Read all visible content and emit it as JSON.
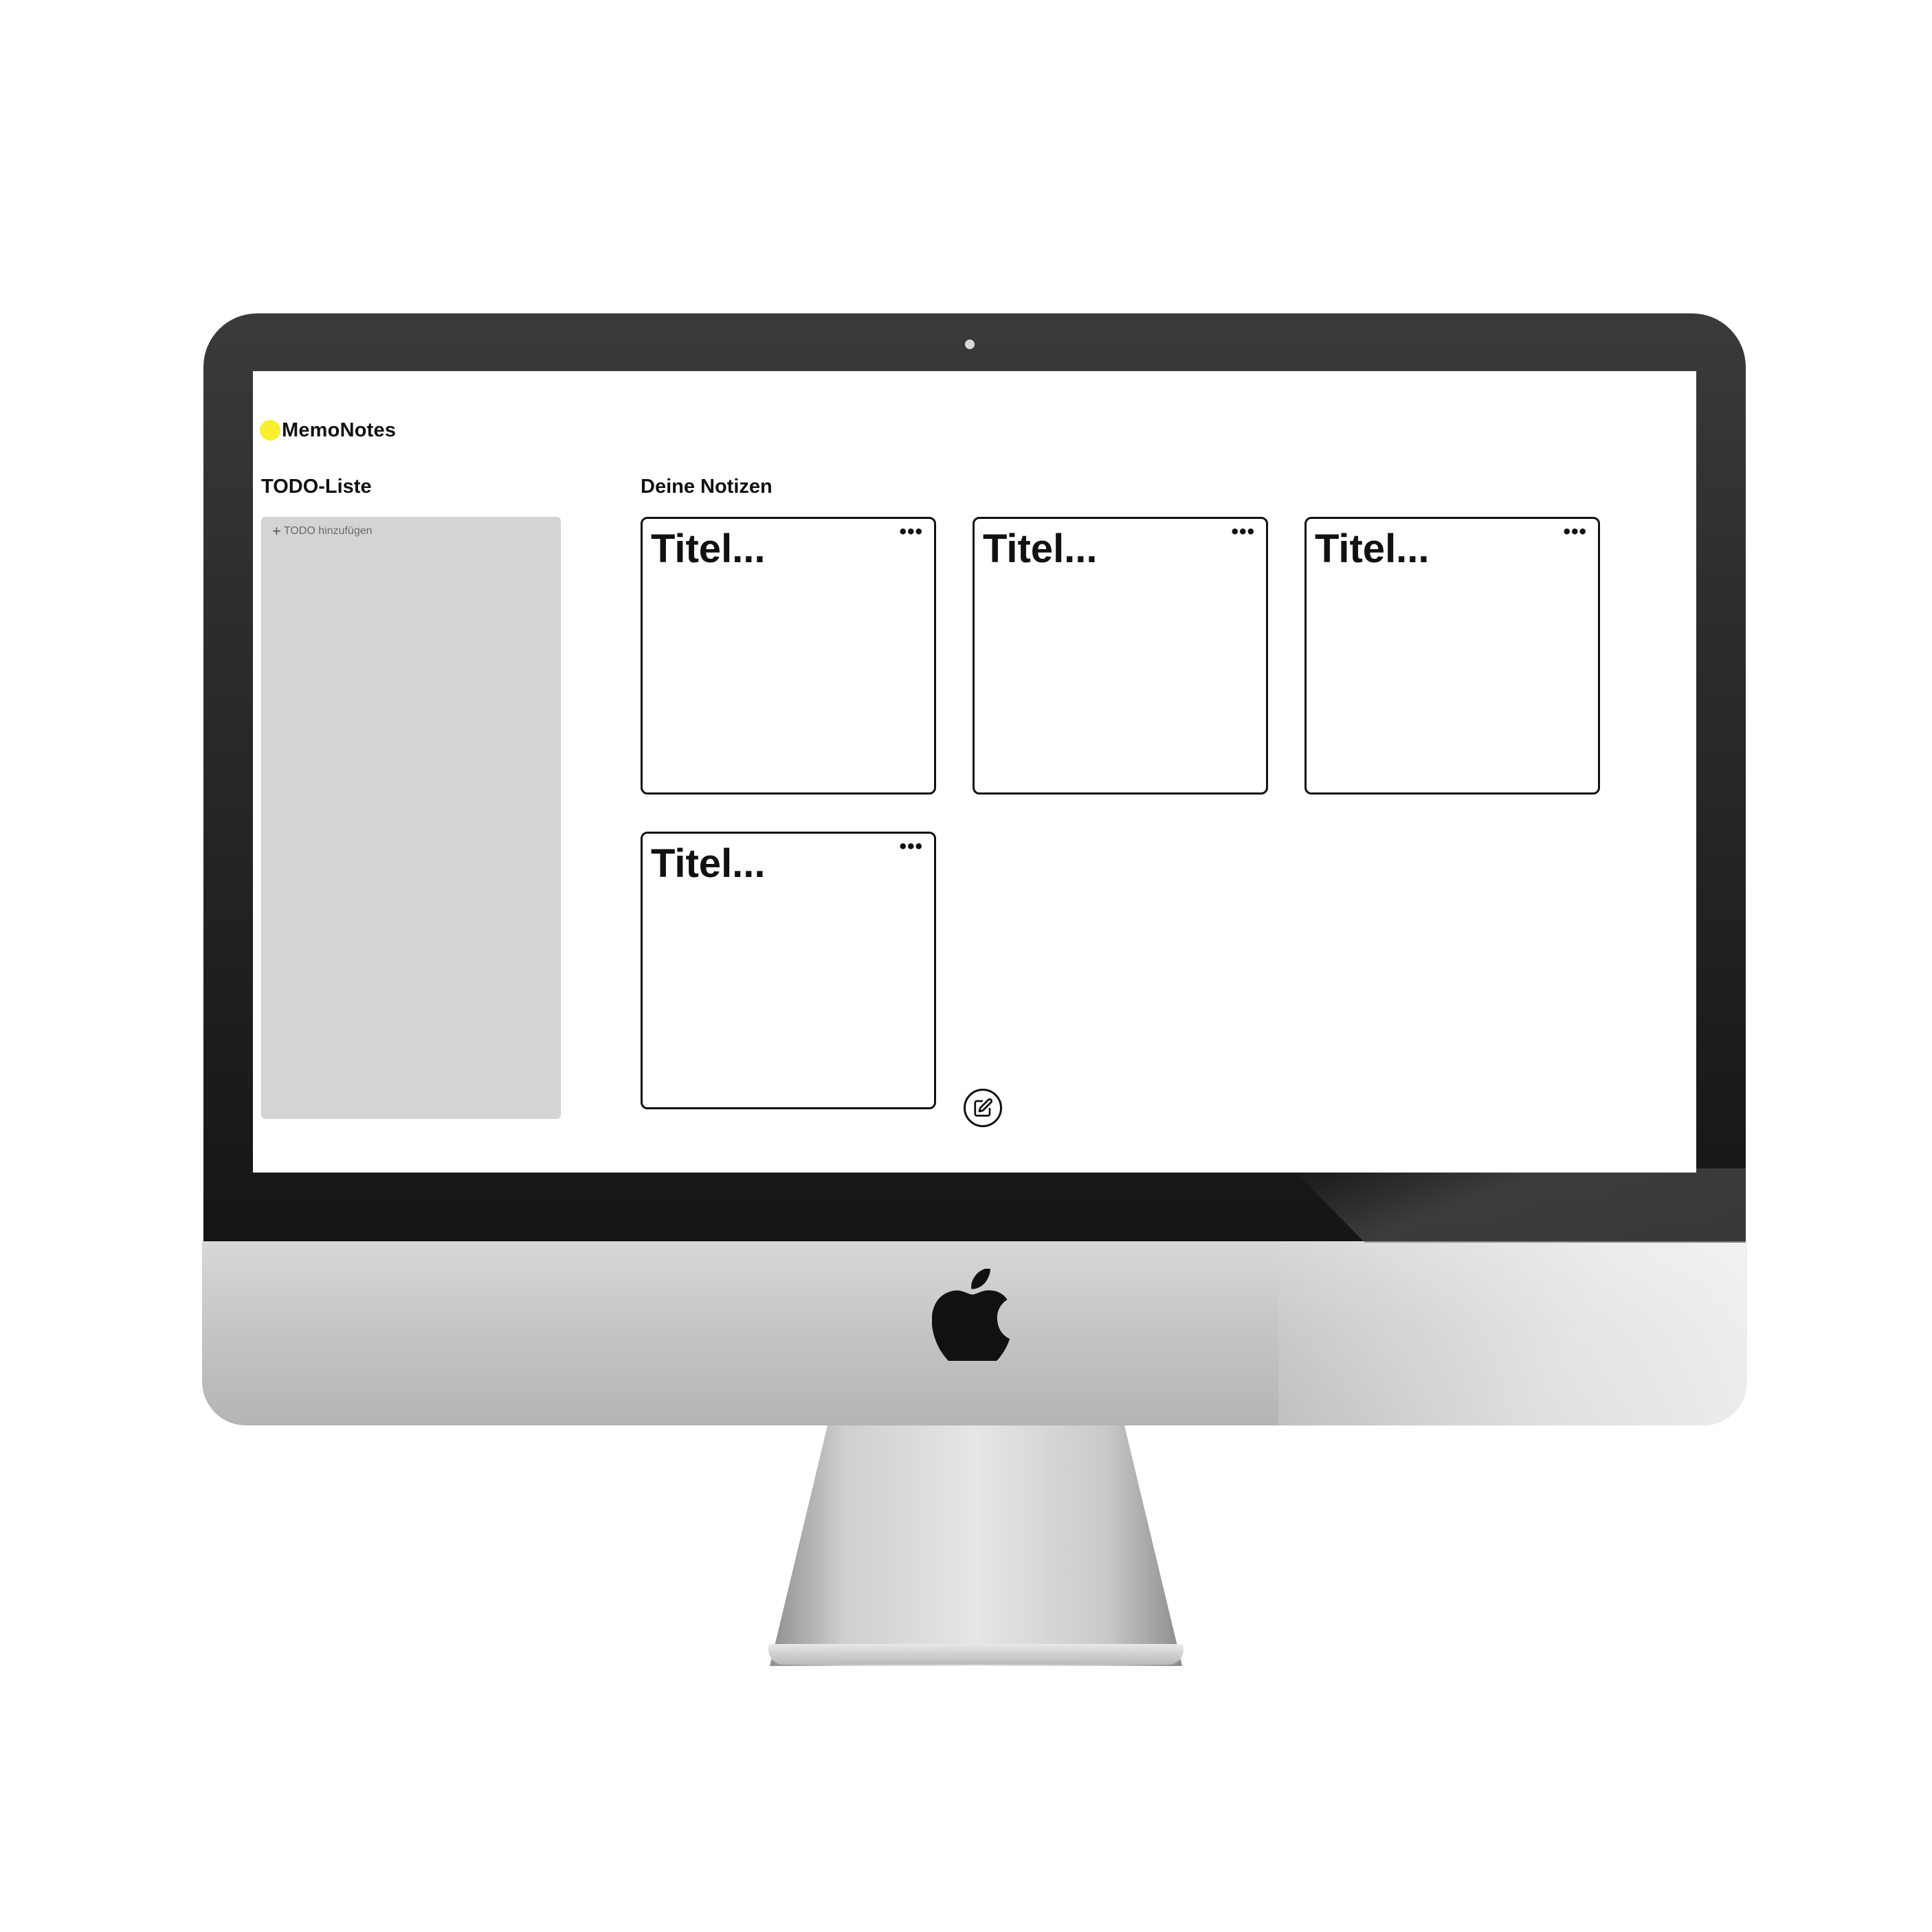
{
  "app": {
    "brand_name": "MemoNotes",
    "brand_color": "#f7ef2f"
  },
  "todo": {
    "section_title": "TODO-Liste",
    "add_label": "TODO hinzufügen",
    "add_icon": "plus-icon",
    "panel_color": "#d4d4d4"
  },
  "notes": {
    "section_title": "Deine Notizen",
    "items": [
      {
        "title": "Titel...",
        "menu_icon": "more-horizontal-icon"
      },
      {
        "title": "Titel...",
        "menu_icon": "more-horizontal-icon"
      },
      {
        "title": "Titel...",
        "menu_icon": "more-horizontal-icon"
      },
      {
        "title": "Titel...",
        "menu_icon": "more-horizontal-icon"
      }
    ],
    "menu_glyph": "•••"
  },
  "actions": {
    "new_note_icon": "edit-icon"
  },
  "device": {
    "logo_icon": "apple-logo-icon"
  }
}
